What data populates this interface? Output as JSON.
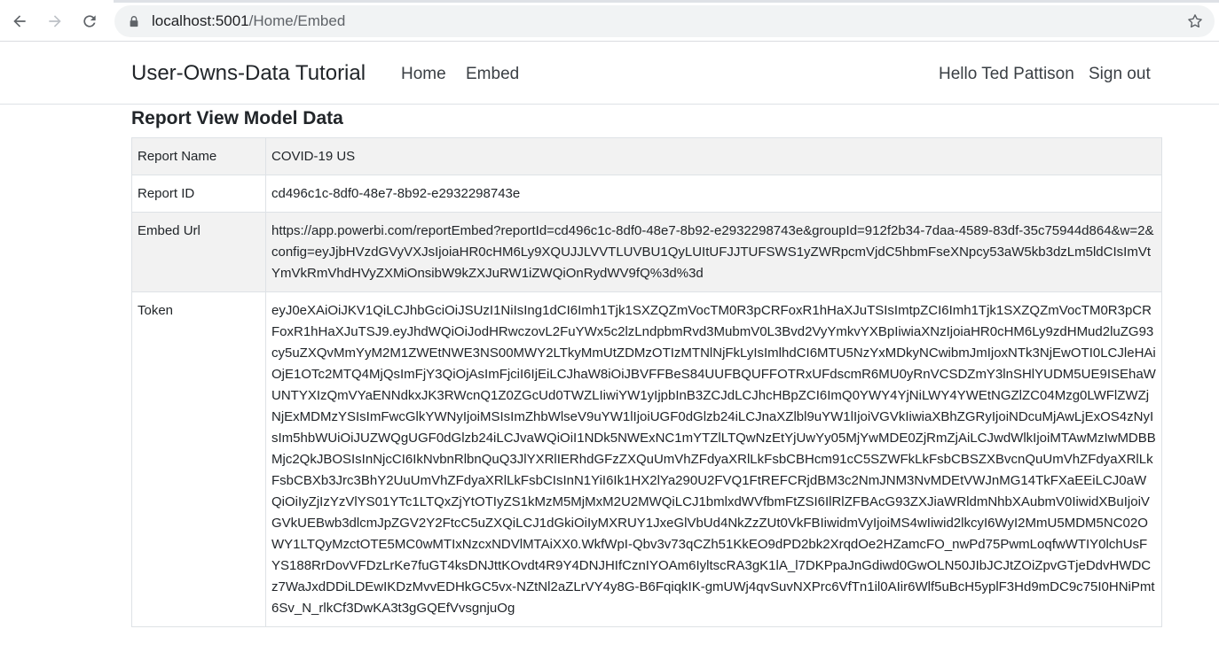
{
  "browser": {
    "url_host": "localhost:5001",
    "url_path": "/Home/Embed"
  },
  "nav": {
    "brand": "User-Owns-Data Tutorial",
    "home": "Home",
    "embed": "Embed",
    "greeting": "Hello Ted Pattison",
    "signout": "Sign out"
  },
  "main": {
    "title": "Report View Model Data",
    "rows": [
      {
        "label": "Report Name",
        "value": "COVID-19 US"
      },
      {
        "label": "Report ID",
        "value": "cd496c1c-8df0-48e7-8b92-e2932298743e"
      },
      {
        "label": "Embed Url",
        "value": "https://app.powerbi.com/reportEmbed?reportId=cd496c1c-8df0-48e7-8b92-e2932298743e&groupId=912f2b34-7daa-4589-83df-35c75944d864&w=2&config=eyJjbHVzdGVyVXJsIjoiaHR0cHM6Ly9XQUJJLVVTLUVBU1QyLUItUFJJTUFSWS1yZWRpcmVjdC5hbmFseXNpcy53aW5kb3dzLm5ldCIsImVtYmVkRmVhdHVyZXMiOnsibW9kZXJuRW1iZWQiOnRydWV9fQ%3d%3d"
      },
      {
        "label": "Token",
        "value": "eyJ0eXAiOiJKV1QiLCJhbGciOiJSUzI1NiIsIng1dCI6Imh1Tjk1SXZQZmVocTM0R3pCRFoxR1hHaXJuTSIsImtpZCI6Imh1Tjk1SXZQZmVocTM0R3pCRFoxR1hHaXJuTSJ9.eyJhdWQiOiJodHRwczovL2FuYWx5c2lzLndpbmRvd3MubmV0L3Bvd2VyYmkvYXBpIiwiaXNzIjoiaHR0cHM6Ly9zdHMud2luZG93cy5uZXQvMmYyM2M1ZWEtNWE3NS00MWY2LTkyMmUtZDMzOTIzMTNlNjFkLyIsImlhdCI6MTU5NzYxMDkyNCwibmJmIjoxNTk3NjEwOTI0LCJleHAiOjE1OTc2MTQ4MjQsImFjY3QiOjAsImFjciI6IjEiLCJhaW8iOiJBVFFBeS84UUFBQUFFOTRxUFdscmR6MU0yRnVCSDZmY3lnSHlYUDM5UE9ISEhaWUNTYXIzQmVYaENNdkxJK3RWcnQ1Z0ZGcUd0TWZLIiwiYW1yIjpbInB3ZCJdLCJhcHBpZCI6ImQ0YWY4YjNiLWY4YWEtNGZlZC04Mzg0LWFlZWZjNjExMDMzYSIsImFwcGlkYWNyIjoiMSIsImZhbWlseV9uYW1lIjoiUGF0dGlzb24iLCJnaXZlbl9uYW1lIjoiVGVkIiwiaXBhZGRyIjoiNDcuMjAwLjExOS4zNyIsIm5hbWUiOiJUZWQgUGF0dGlzb24iLCJvaWQiOiI1NDk5NWExNC1mYTZlLTQwNzEtYjUwYy05MjYwMDE0ZjRmZjAiLCJwdWlkIjoiMTAwMzIwMDBBMjc2QkJBOSIsInNjcCI6IkNvbnRlbnQuQ3JlYXRlIERhdGFzZXQuUmVhZFdyaXRlLkFsbCBHcm91cC5SZWFkLkFsbCBSZXBvcnQuUmVhZFdyaXRlLkFsbCBXb3Jrc3BhY2UuUmVhZFdyaXRlLkFsbCIsInN1YiI6Ik1HX2lYa290U2FVQ1FtREFCRjdBM3c2NmJNM3NvMDEtVWJnMG14TkFXaEEiLCJ0aWQiOiIyZjIzYzVlYS01YTc1LTQxZjYtOTIyZS1kMzM5MjMxM2U2MWQiLCJ1bmlxdWVfbmFtZSI6IlRlZFBAcG93ZXJiaWRldmNhbXAubmV0IiwidXBuIjoiVGVkUEBwb3dlcmJpZGV2Y2FtcC5uZXQiLCJ1dGkiOiIyMXRUY1JxeGlVbUd4NkZzZUt0VkFBIiwidmVyIjoiMS4wIiwid2lkcyI6WyI2MmU5MDM5NC02OWY1LTQyMzctOTE5MC0wMTIxNzcxNDVlMTAiXX0.WkfWpI-Qbv3v73qCZh51KkEO9dPD2bk2XrqdOe2HZamcFO_nwPd75PwmLoqfwWTIY0lchUsFYS188RrDovVFDzLrKe7fuGT4ksDNJttKOvdt4R9Y4DNJHIfCznIYOAm6IyltscRA3gK1lA_l7DKPpaJnGdiwd0GwOLN50JIbJCJtZOiZpvGTjeDdvHWDCz7WaJxdDDiLDEwIKDzMvvEDHkGC5vx-NZtNl2aZLrVY4y8G-B6FqiqkIK-gmUWj4qvSuvNXPrc6VfTn1il0AIir6Wlf5uBcH5yplF3Hd9mDC9c75I0HNiPmt6Sv_N_rlkCf3DwKA3t3gGQEfVvsgnjuOg"
      }
    ]
  }
}
